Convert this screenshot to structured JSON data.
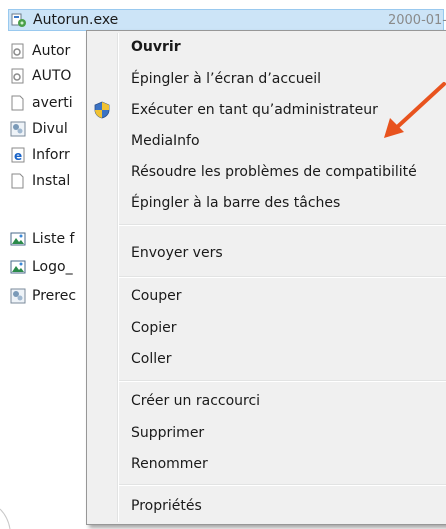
{
  "explorer": {
    "files": [
      {
        "name": "Autorun.exe",
        "date": "2000-01-",
        "icon": "autorun-exe-icon",
        "selected": true
      },
      {
        "name": "Autor",
        "icon": "setup-icon"
      },
      {
        "name": "AUTO",
        "icon": "setup-icon"
      },
      {
        "name": "averti",
        "icon": "text-file-icon"
      },
      {
        "name": "Divul",
        "icon": "settings-file-icon"
      },
      {
        "name": "Inforr",
        "icon": "html-file-icon"
      },
      {
        "name": "Instal",
        "icon": "text-file-icon"
      },
      {
        "name": "Liste f",
        "icon": "image-file-icon"
      },
      {
        "name": "Logo_",
        "icon": "image-file-icon"
      },
      {
        "name": "Prerec",
        "icon": "settings-file-icon"
      }
    ]
  },
  "context_menu": {
    "items": [
      {
        "label": "Ouvrir",
        "bold": true
      },
      {
        "label": "Épingler à l’écran d’accueil"
      },
      {
        "label": "Exécuter en tant qu’administrateur",
        "icon": "uac-shield-icon"
      },
      {
        "label": "MediaInfo"
      },
      {
        "label": "Résoudre les problèmes de compatibilité"
      },
      {
        "label": "Épingler à la barre des tâches"
      },
      {
        "label": "Envoyer vers"
      },
      {
        "label": "Couper"
      },
      {
        "label": "Copier"
      },
      {
        "label": "Coller"
      },
      {
        "label": "Créer un raccourci"
      },
      {
        "label": "Supprimer"
      },
      {
        "label": "Renommer"
      },
      {
        "label": "Propriétés"
      }
    ]
  },
  "colors": {
    "arrow": "#e8531e",
    "selection": "#cce4f7",
    "menu_background": "#f0f0f0"
  }
}
